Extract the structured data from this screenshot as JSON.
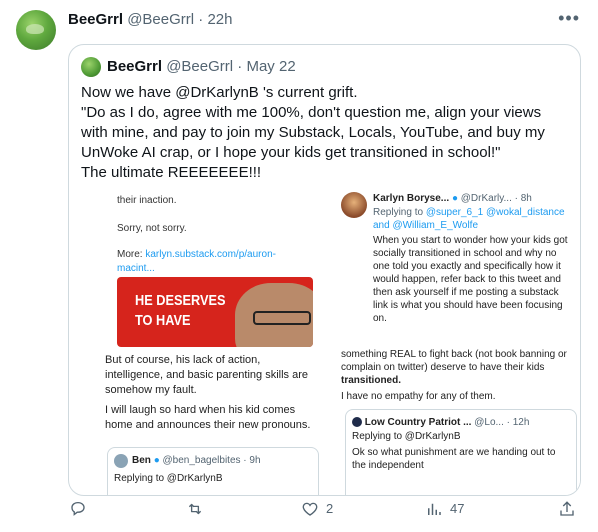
{
  "tweet": {
    "name": "BeeGrrl",
    "handle": "@BeeGrrl",
    "time": "22h"
  },
  "quote": {
    "name": "BeeGrrl",
    "handle": "@BeeGrrl",
    "date": "May 22",
    "text": "Now we have @DrKarlynB 's current grift.\n\"Do as I do, agree with me 100%, don't question me, align your views with mine, and pay to join my Substack, Locals, YouTube, and buy my UnWoke AI crap, or I hope your kids get transitioned in school!\"\nThe ultimate REEEEEEE!!!"
  },
  "image": {
    "left_top_partial": "their inaction.",
    "left_sorry": "Sorry, not sorry.",
    "left_more_label": "More:",
    "left_more_link": "karlyn.substack.com/p/auron-macint...",
    "red_title_line1": "HE DESERVES",
    "red_title_line2": "TO HAVE",
    "left_paragraph1": "But of course, his lack of action, intelligence, and basic parenting skills are somehow my fault.",
    "left_paragraph2": "I will laugh so hard when his kid comes home and announces their new pronouns.",
    "left_card_name": "Ben",
    "left_card_handle": "@ben_bagelbites · 9h",
    "left_card_reply": "Replying to @DrKarlynB",
    "right_name": "Karlyn Boryse...",
    "right_handle": "@DrKarly... · 8h",
    "right_replying_label": "Replying to",
    "right_replying_links": "@super_6_1 @wokal_distance and @William_E_Wolfe",
    "right_body": "When you start to wonder how your kids got socially transitioned in school and why no one told you exactly and specifically how it would happen, refer back to this tweet and then ask yourself if me posting a substack link is what you should have been focusing on.",
    "right_mid_partial": "something REAL to fight back (not book banning or complain on twitter) deserve to have their kids",
    "right_mid_bold": "transitioned.",
    "right_no_empathy": "I have no empathy for any of them.",
    "right_card_name": "Low Country Patriot ...",
    "right_card_handle": "@Lo... · 12h",
    "right_card_reply": "Replying to @DrKarlynB",
    "right_card_text": "Ok so what punishment are we handing out to the independent"
  },
  "actions": {
    "likes": "2",
    "views": "47"
  }
}
